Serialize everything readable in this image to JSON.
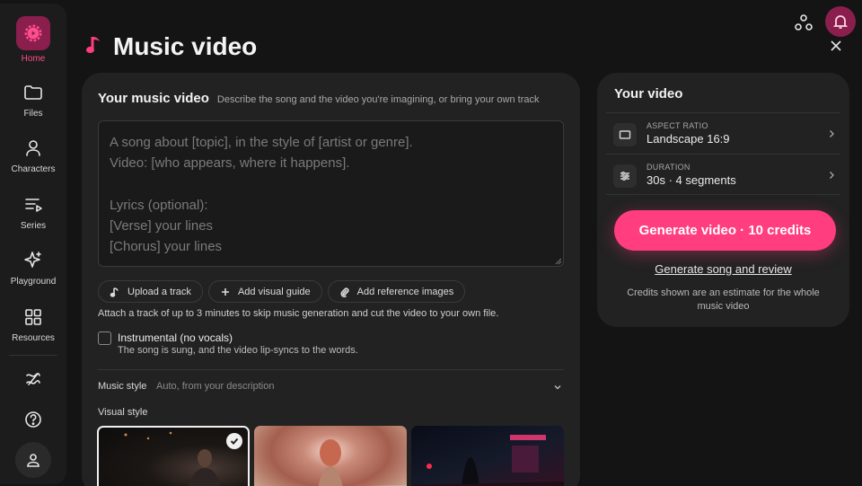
{
  "sidebar": {
    "items": [
      {
        "label": "Home",
        "icon": "home-icon"
      },
      {
        "label": "Files",
        "icon": "folder-icon"
      },
      {
        "label": "Characters",
        "icon": "person-icon"
      },
      {
        "label": "Series",
        "icon": "series-icon"
      },
      {
        "label": "Playground",
        "icon": "sparkle-icon"
      },
      {
        "label": "Resources",
        "icon": "grid-icon"
      }
    ],
    "bottom_icons": [
      "squiggle-icon",
      "help-icon",
      "profile-icon"
    ]
  },
  "header": {
    "title": "Music video",
    "title_icon": "music-note-icon",
    "accent": "#ff3d7f"
  },
  "main": {
    "heading": "Your music video",
    "subheading": "Describe the song and the video you're imagining, or bring your own track",
    "prompt_placeholder": "A song about [topic], in the style of [artist or genre].\nVideo: [who appears, where it happens].\n\nLyrics (optional):\n[Verse] your lines\n[Chorus] your lines",
    "chips": [
      {
        "label": "Upload a track",
        "icon": "music-note-icon"
      },
      {
        "label": "Add visual guide",
        "icon": "plus-icon"
      },
      {
        "label": "Add reference images",
        "icon": "paperclip-icon"
      }
    ],
    "hint": "Attach a track of up to 3 minutes to skip music generation and cut the video to your own file.",
    "instrumental": {
      "label": "Instrumental (no vocals)",
      "sub": "The song is sung, and the video lip-syncs to the words.",
      "checked": false
    },
    "music_style": {
      "label": "Music style",
      "value": "Auto, from your description"
    },
    "visual_style_label": "Visual style",
    "visual_styles": [
      {
        "name": "stage-singer",
        "selected": true
      },
      {
        "name": "golden-field",
        "selected": false
      },
      {
        "name": "neon-street",
        "selected": false
      }
    ]
  },
  "side": {
    "heading": "Your video",
    "settings": [
      {
        "caption": "ASPECT RATIO",
        "value": "Landscape 16:9",
        "icon": "aspect-ratio-icon"
      },
      {
        "caption": "DURATION",
        "value": "30s · 4 segments",
        "icon": "sliders-icon"
      }
    ],
    "generate_label": "Generate video · 10 credits",
    "song_link": "Generate song and review",
    "credits_note": "Credits shown are an estimate for the whole music video"
  }
}
